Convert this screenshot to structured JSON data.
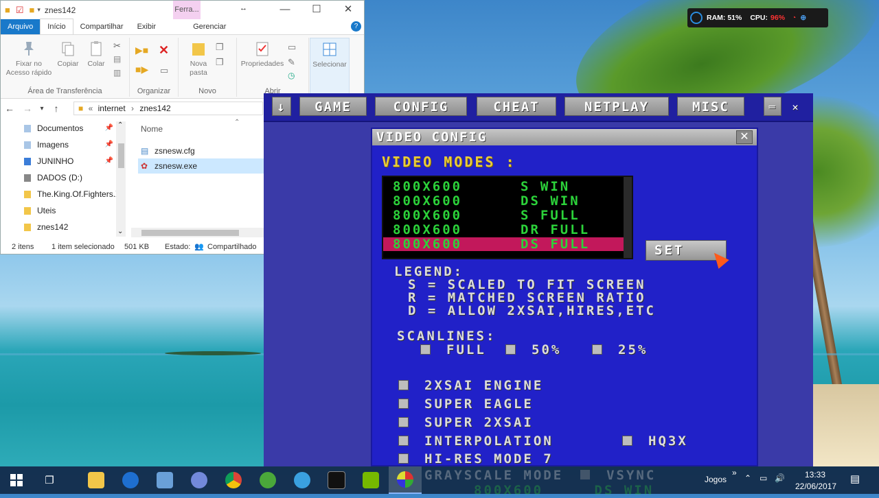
{
  "explorer": {
    "title": "znes142",
    "contextual_tab": "Ferra...",
    "controls": {
      "minimize": "—",
      "maximize": "☐",
      "close": "✕"
    },
    "tabs": [
      "Arquivo",
      "Início",
      "Compartilhar",
      "Exibir",
      "Gerenciar"
    ],
    "ribbon": {
      "pin_label": "Fixar no Acesso rápido",
      "copy_label": "Copiar",
      "paste_label": "Colar",
      "clipboard_group": "Área de Transferência",
      "organize_group": "Organizar",
      "new_folder_label": "Nova pasta",
      "new_group": "Novo",
      "properties_label": "Propriedades",
      "open_group": "Abrir",
      "select_label": "Selecionar"
    },
    "breadcrumb": {
      "prefix": "«",
      "parts": [
        "internet",
        "znes142"
      ],
      "sep": "›"
    },
    "nav_items": [
      {
        "label": "Documentos",
        "pinned": true
      },
      {
        "label": "Imagens",
        "pinned": true
      },
      {
        "label": "JUNINHO",
        "pinned": true
      },
      {
        "label": "DADOS (D:)",
        "pinned": false
      },
      {
        "label": "The.King.Of.Fighters.X",
        "pinned": false
      },
      {
        "label": "Uteis",
        "pinned": false
      },
      {
        "label": "znes142",
        "pinned": false
      }
    ],
    "column_header": "Nome",
    "files": [
      {
        "name": "zsnesw.cfg",
        "selected": false
      },
      {
        "name": "zsnesw.exe",
        "selected": true
      }
    ],
    "status": {
      "count": "2 itens",
      "selection": "1 item selecionado",
      "size": "501 KB",
      "state": "Estado:",
      "shared": "Compartilhado"
    }
  },
  "hud": {
    "ram": "RAM: 51%",
    "cpu_label": "CPU:",
    "cpu_value": "96%"
  },
  "zsnes": {
    "menu": [
      "↓",
      "GAME",
      "CONFIG",
      "CHEAT",
      "NETPLAY",
      "MISC"
    ],
    "window_controls": {
      "minimize": "═",
      "close": "✕"
    },
    "dialog": {
      "title": "VIDEO CONFIG",
      "close": "✕",
      "modes_label": "VIDEO MODES :",
      "modes": [
        {
          "res": "800X600",
          "mode": "S WIN",
          "selected": false
        },
        {
          "res": "800X600",
          "mode": "DS WIN",
          "selected": false
        },
        {
          "res": "800X600",
          "mode": "S FULL",
          "selected": false
        },
        {
          "res": "800X600",
          "mode": "DR FULL",
          "selected": false
        },
        {
          "res": "800X600",
          "mode": "DS FULL",
          "selected": true
        }
      ],
      "set_button": "SET",
      "legend_title": "LEGEND:",
      "legend": [
        "S = SCALED TO FIT SCREEN",
        "R = MATCHED SCREEN RATIO",
        "D = ALLOW 2XSAI,HIRES,ETC"
      ],
      "scanlines_label": "SCANLINES:",
      "scanlines": [
        "FULL",
        "50%",
        "25%"
      ],
      "filters": [
        "2XSAI ENGINE",
        "SUPER EAGLE",
        "SUPER 2XSAI",
        "INTERPOLATION",
        "HI-RES MODE 7"
      ],
      "hq3x_label": "HQ3X",
      "grayscale_label": "GRAYSCALE MODE",
      "vsync_label": "VSYNC",
      "footer_res": "800X600",
      "footer_mode": "DS WIN"
    }
  },
  "taskbar": {
    "apps": [
      "start",
      "task-view",
      "file-explorer",
      "ccleaner",
      "pc-app",
      "discord",
      "chrome",
      "utorrent",
      "bubbles",
      "terminal",
      "nvidia",
      "zsnes"
    ],
    "jogos_label": "Jogos",
    "expand": "»",
    "time": "13:33",
    "date": "22/06/2017"
  }
}
